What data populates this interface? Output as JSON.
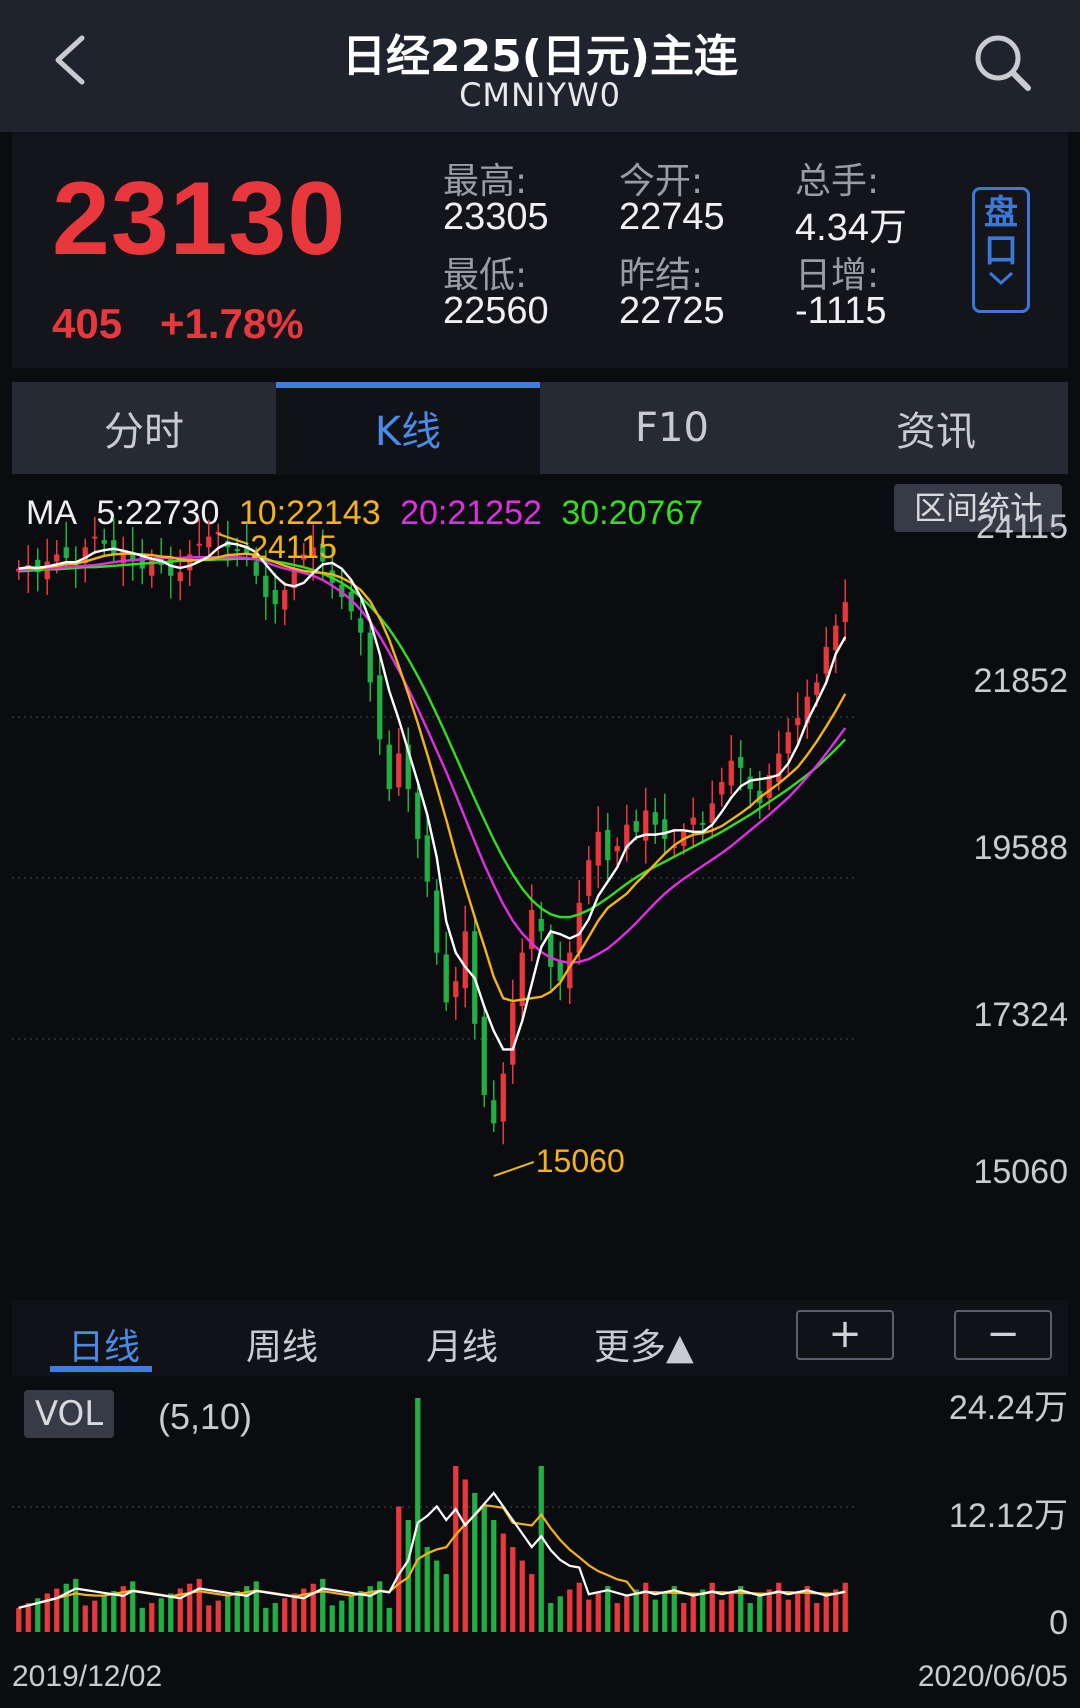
{
  "header": {
    "title": "日经225(日元)主连",
    "code": "CMNIYW0"
  },
  "quote": {
    "price": "23130",
    "change": "405",
    "change_pct": "+1.78%",
    "stats": [
      {
        "label": "最高:",
        "value": "23305"
      },
      {
        "label": "今开:",
        "value": "22745"
      },
      {
        "label": "总手:",
        "value": "4.34万"
      },
      {
        "label": "最低:",
        "value": "22560"
      },
      {
        "label": "昨结:",
        "value": "22725"
      },
      {
        "label": "日增:",
        "value": "-1115"
      }
    ],
    "pankou_label": "盘口"
  },
  "tabs": [
    "分时",
    "K线",
    "F10",
    "资讯"
  ],
  "active_tab": "K线",
  "ma": {
    "label": "MA",
    "ma5": "5:22730",
    "ma10": "10:22143",
    "ma20": "20:21252",
    "ma30": "30:20767"
  },
  "range_button": "区间统计",
  "price_axis": [
    "24115",
    "21852",
    "19588",
    "17324",
    "15060"
  ],
  "high_marker": "24115",
  "low_marker": "15060",
  "periods": [
    "日线",
    "周线",
    "月线",
    "更多▲"
  ],
  "active_period": "日线",
  "zoom": {
    "plus": "+",
    "minus": "−"
  },
  "volume": {
    "badge": "VOL",
    "params": "(5,10)",
    "axis": [
      "24.24万",
      "12.12万",
      "0"
    ]
  },
  "dates": {
    "start": "2019/12/02",
    "end": "2020/06/05"
  },
  "colors": {
    "up": "#e8383d",
    "down": "#22b045",
    "ma5": "#ffffff",
    "ma10": "#f2b21a",
    "ma20": "#e02fe0",
    "ma30": "#33dd22",
    "accent": "#3d7fe0"
  },
  "chart_data": {
    "type": "candlestick",
    "y_range": [
      15060,
      24115
    ],
    "closes": [
      23600,
      23650,
      23550,
      23700,
      23800,
      23750,
      23650,
      23900,
      24050,
      23950,
      23800,
      23850,
      23700,
      23600,
      23750,
      23650,
      23500,
      23550,
      23800,
      23950,
      24050,
      24115,
      23900,
      23850,
      23800,
      23500,
      23200,
      23100,
      23300,
      23600,
      23800,
      23900,
      23700,
      23400,
      23200,
      23000,
      22700,
      22000,
      21200,
      20500,
      21000,
      20500,
      19800,
      19200,
      18200,
      17500,
      17800,
      18500,
      17200,
      16200,
      15800,
      16500,
      17500,
      18200,
      18800,
      18500,
      18000,
      17800,
      18200,
      18900,
      19500,
      19900,
      19500,
      19700,
      20000,
      19900,
      20200,
      20000,
      19800,
      19700,
      19900,
      20100,
      20000,
      20300,
      20600,
      20900,
      20800,
      20500,
      20300,
      20700,
      21000,
      21300,
      21500,
      21800,
      22000,
      22500,
      22800,
      23130
    ],
    "ma5": [
      23600,
      23620,
      23610,
      23630,
      23660,
      23690,
      23690,
      23750,
      23830,
      23860,
      23880,
      23850,
      23820,
      23780,
      23740,
      23710,
      23640,
      23610,
      23640,
      23700,
      23770,
      23890,
      23960,
      23940,
      23900,
      23830,
      23660,
      23500,
      23380,
      23350,
      23400,
      23540,
      23660,
      23680,
      23600,
      23440,
      23200,
      22860,
      22400,
      21880,
      21480,
      21040,
      20600,
      20140,
      19540,
      18640,
      18200,
      18000,
      17840,
      17440,
      17100,
      16840,
      16840,
      17240,
      17760,
      18280,
      18500,
      18460,
      18400,
      18460,
      18670,
      19000,
      19200,
      19400,
      19690,
      19820,
      19860,
      19860,
      19880,
      19920,
      19920,
      19900,
      19900,
      20000,
      20180,
      20380,
      20540,
      20620,
      20640,
      20660,
      20700,
      20860,
      21120,
      21460,
      21720,
      22000,
      22400,
      22640
    ],
    "ma10": [
      23600,
      23610,
      23600,
      23620,
      23640,
      23660,
      23670,
      23700,
      23740,
      23780,
      23800,
      23810,
      23810,
      23800,
      23790,
      23770,
      23760,
      23730,
      23720,
      23720,
      23730,
      23760,
      23790,
      23800,
      23810,
      23790,
      23740,
      23690,
      23640,
      23600,
      23570,
      23550,
      23540,
      23520,
      23470,
      23400,
      23300,
      23140,
      22900,
      22600,
      22230,
      21840,
      21430,
      20990,
      20530,
      20070,
      19580,
      19130,
      18700,
      18290,
      17860,
      17560,
      17520,
      17540,
      17560,
      17580,
      17650,
      17780,
      18000,
      18200,
      18420,
      18650,
      18830,
      18930,
      19030,
      19180,
      19310,
      19450,
      19590,
      19710,
      19800,
      19860,
      19880,
      19920,
      19980,
      20070,
      20160,
      20260,
      20380,
      20480,
      20580,
      20690,
      20810,
      20980,
      21170,
      21380,
      21600,
      21840
    ],
    "ma20": [
      23580,
      23590,
      23600,
      23600,
      23610,
      23620,
      23630,
      23640,
      23650,
      23670,
      23690,
      23710,
      23720,
      23730,
      23740,
      23750,
      23750,
      23750,
      23760,
      23760,
      23760,
      23760,
      23760,
      23760,
      23750,
      23730,
      23690,
      23640,
      23600,
      23570,
      23540,
      23500,
      23440,
      23360,
      23270,
      23160,
      23020,
      22850,
      22650,
      22420,
      22170,
      21910,
      21630,
      21340,
      21040,
      20740,
      20420,
      20090,
      19760,
      19440,
      19150,
      18880,
      18650,
      18470,
      18330,
      18210,
      18130,
      18080,
      18060,
      18070,
      18110,
      18180,
      18260,
      18370,
      18490,
      18620,
      18760,
      18900,
      19030,
      19140,
      19240,
      19330,
      19420,
      19510,
      19600,
      19700,
      19810,
      19920,
      20030,
      20140,
      20260,
      20380,
      20520,
      20670,
      20830,
      21000,
      21180,
      21360
    ],
    "ma30": [
      23560,
      23570,
      23580,
      23590,
      23590,
      23600,
      23610,
      23620,
      23620,
      23630,
      23640,
      23650,
      23660,
      23670,
      23680,
      23690,
      23700,
      23710,
      23710,
      23720,
      23720,
      23730,
      23730,
      23740,
      23740,
      23730,
      23720,
      23700,
      23680,
      23650,
      23620,
      23580,
      23530,
      23470,
      23400,
      23310,
      23200,
      23070,
      22920,
      22750,
      22550,
      22330,
      22090,
      21830,
      21550,
      21260,
      20960,
      20660,
      20360,
      20070,
      19790,
      19530,
      19300,
      19100,
      18940,
      18820,
      18740,
      18700,
      18700,
      18740,
      18800,
      18880,
      18970,
      19070,
      19170,
      19260,
      19340,
      19410,
      19480,
      19550,
      19620,
      19690,
      19760,
      19830,
      19900,
      19980,
      20060,
      20140,
      20230,
      20320,
      20410,
      20500,
      20600,
      20700,
      20810,
      20930,
      21060,
      21200
    ],
    "volume_range": [
      0,
      242400
    ]
  }
}
